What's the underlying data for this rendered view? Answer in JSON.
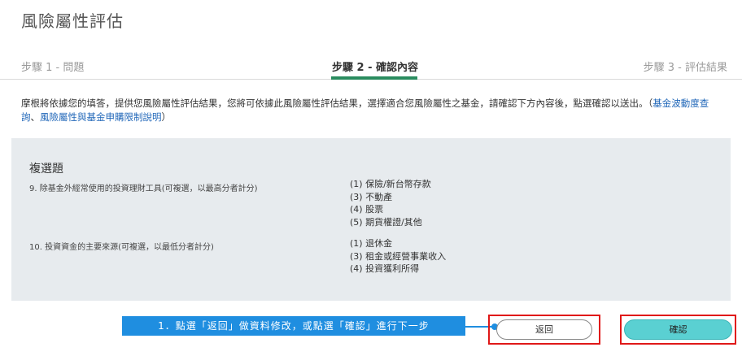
{
  "page": {
    "title": "風險屬性評估"
  },
  "steps": [
    {
      "label": "步驟 1 - 問題",
      "active": false
    },
    {
      "label": "步驟 2 - 確認內容",
      "active": true
    },
    {
      "label": "步驟 3 - 評估結果",
      "active": false
    }
  ],
  "intro": {
    "text": "摩根將依據您的填答，提供您風險屬性評估結果，您將可依據此風險屬性評估結果，選擇適合您風險屬性之基金，請確認下方內容後，點選確認以送出。（",
    "link1": "基金波動度查詢",
    "sep": "、",
    "link2": "風險屬性與基金申購限制說明",
    "close": "）"
  },
  "panel": {
    "section_title": "複選題",
    "questions": [
      {
        "text": "9. 除基金外經常使用的投資理財工具(可複選，以最高分者計分)",
        "answers": [
          "(1) 保險/新台幣存款",
          "(3) 不動產",
          "(4) 股票",
          "(5) 期貨權證/其他"
        ]
      },
      {
        "text": "10. 投資資金的主要來源(可複選，以最低分者計分)",
        "answers": [
          "(1) 退休金",
          "(3) 租金或經營事業收入",
          "(4) 投資獲利所得"
        ]
      }
    ]
  },
  "callout": {
    "text": "1．點選「返回」做資料修改，或點選「確認」進行下一步"
  },
  "buttons": {
    "back": "返回",
    "confirm": "確認"
  },
  "colors": {
    "accent_green": "#2a8c5f",
    "confirm_teal": "#5ad0d2",
    "callout_blue": "#1f8ee0",
    "highlight_red": "#e01818",
    "link_blue": "#1f66b8"
  }
}
